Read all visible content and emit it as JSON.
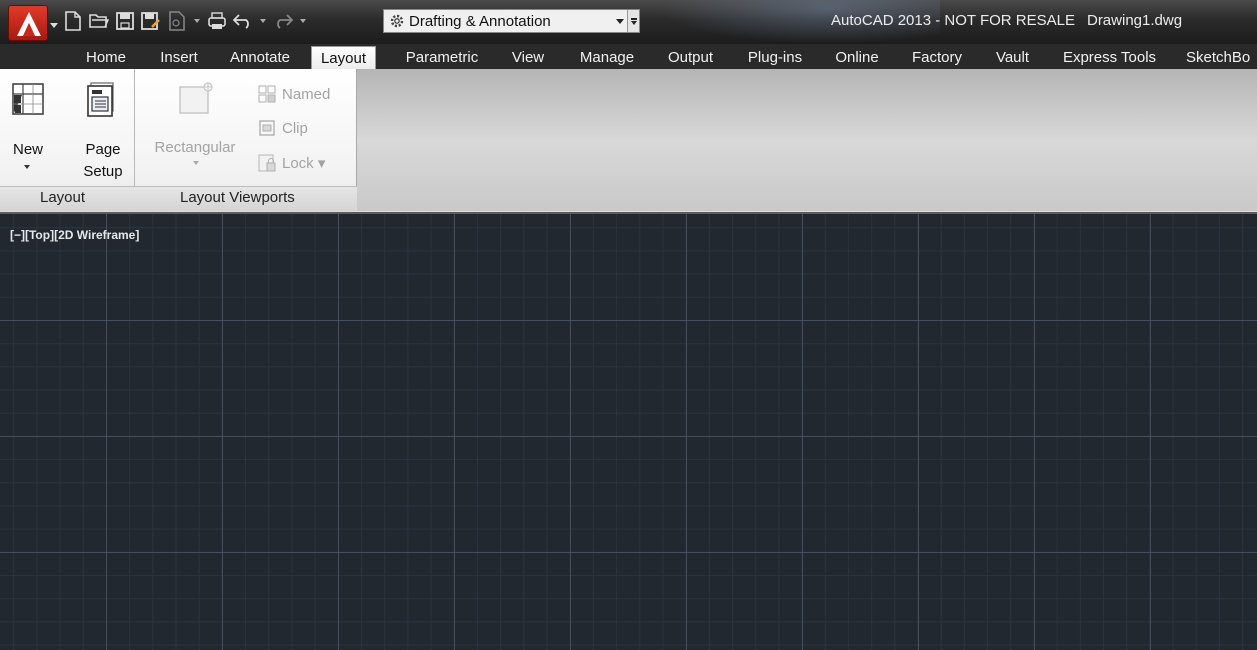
{
  "title_bar": {
    "app": "AutoCAD 2013 - NOT FOR RESALE",
    "document": "Drawing1.dwg",
    "workspace": "Drafting & Annotation"
  },
  "quick_access": {
    "icons": [
      "new-icon",
      "open-icon",
      "save-icon",
      "save-as-icon",
      "plot-preview-icon",
      "plot-icon",
      "undo-icon",
      "redo-icon",
      "gear-icon"
    ]
  },
  "tabs": [
    {
      "label": "Home"
    },
    {
      "label": "Insert"
    },
    {
      "label": "Annotate"
    },
    {
      "label": "Layout",
      "active": true
    },
    {
      "label": "Parametric"
    },
    {
      "label": "View"
    },
    {
      "label": "Manage"
    },
    {
      "label": "Output"
    },
    {
      "label": "Plug-ins"
    },
    {
      "label": "Online"
    },
    {
      "label": "Factory"
    },
    {
      "label": "Vault"
    },
    {
      "label": "Express Tools"
    },
    {
      "label": "SketchBo"
    }
  ],
  "ribbon": {
    "layout_panel": {
      "title": "Layout",
      "new_label": "New",
      "page_setup_line1": "Page",
      "page_setup_line2": "Setup"
    },
    "viewports_panel": {
      "title": "Layout Viewports",
      "rectangular_label": "Rectangular",
      "named_label": "Named",
      "clip_label": "Clip",
      "lock_label": "Lock ▾"
    }
  },
  "viewport": {
    "minus": "[−]",
    "view": "[Top]",
    "style": "[2D Wireframe]"
  },
  "colors": {
    "canvas_bg": "#212830",
    "grid_major": "#465260",
    "grid_minor": "#2c353f",
    "ribbon_active_tab": "#ffffff",
    "disabled_text": "#a3a3a3"
  }
}
